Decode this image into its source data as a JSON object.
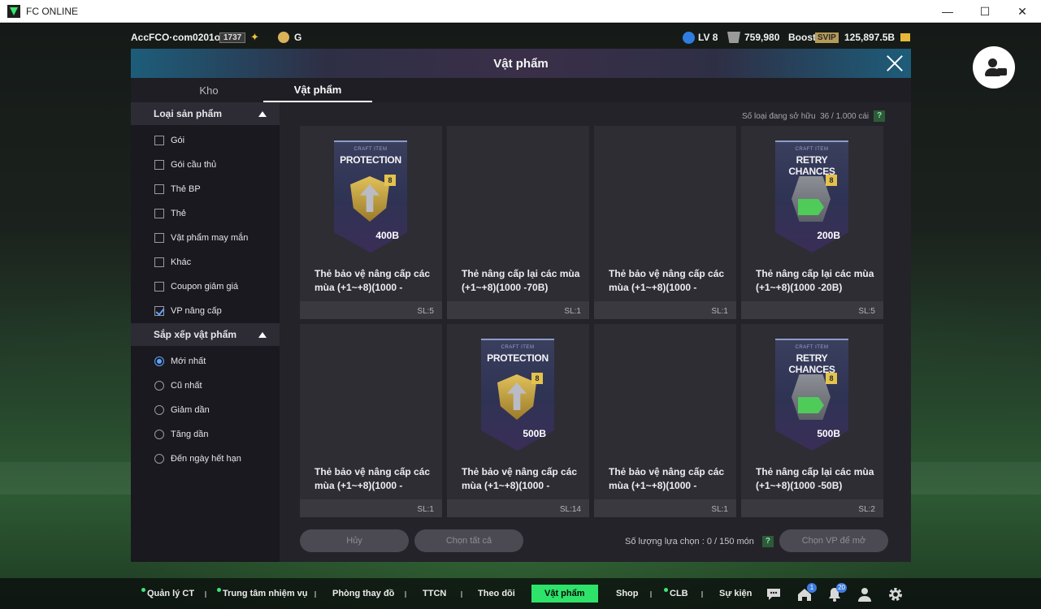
{
  "window": {
    "title": "FC ONLINE",
    "minimize": "—",
    "maximize": "☐",
    "close": "✕"
  },
  "topbar": {
    "username": "AccFCO·com0201oo",
    "user_level": "1737",
    "club_grade": "G",
    "level": "LV 8",
    "bp": "759,980",
    "boost_label": "Boost",
    "svip": "SVIP",
    "coins": "125,897.5B"
  },
  "modal": {
    "title": "Vật phẩm",
    "tabs": [
      {
        "label": "Kho",
        "active": false
      },
      {
        "label": "Vật phẩm",
        "active": true
      }
    ],
    "owned_label": "Số loại đang sở hữu",
    "owned_value": "36 / 1.000 cái",
    "help": "?",
    "sidebar": {
      "category_title": "Loại sản phẩm",
      "categories": [
        {
          "label": "Gói",
          "checked": false
        },
        {
          "label": "Gói cầu thủ",
          "checked": false
        },
        {
          "label": "Thẻ BP",
          "checked": false
        },
        {
          "label": "Thẻ",
          "checked": false
        },
        {
          "label": "Vật phẩm may mắn",
          "checked": false
        },
        {
          "label": "Khác",
          "checked": false
        },
        {
          "label": "Coupon giảm giá",
          "checked": false
        },
        {
          "label": "VP nâng cấp",
          "checked": true
        }
      ],
      "sort_title": "Sắp xếp vật phẩm",
      "sorts": [
        {
          "label": "Mới nhất",
          "selected": true
        },
        {
          "label": "Cũ nhất",
          "selected": false
        },
        {
          "label": "Giảm dần",
          "selected": false
        },
        {
          "label": "Tăng dần",
          "selected": false
        },
        {
          "label": "Đến ngày hết hạn",
          "selected": false
        }
      ]
    },
    "items": [
      {
        "caption": "CRAFT ITEM",
        "type": "PROTECTION",
        "grade": "8",
        "price": "400B",
        "name": "Thẻ bảo vệ nâng cấp các mùa (+1~+8)(1000 -",
        "qty": "SL:5",
        "image": true,
        "kind": "protection"
      },
      {
        "caption": "",
        "type": "",
        "grade": "",
        "price": "",
        "name": "Thẻ nâng cấp lại các mùa (+1~+8)(1000 -70B)",
        "qty": "SL:1",
        "image": false,
        "kind": ""
      },
      {
        "caption": "",
        "type": "",
        "grade": "",
        "price": "",
        "name": "Thẻ bảo vệ nâng cấp các mùa (+1~+8)(1000 -",
        "qty": "SL:1",
        "image": false,
        "kind": ""
      },
      {
        "caption": "CRAFT ITEM",
        "type": "RETRY CHANCES",
        "grade": "8",
        "price": "200B",
        "name": "Thẻ nâng cấp lại các mùa (+1~+8)(1000 -20B)",
        "qty": "SL:5",
        "image": true,
        "kind": "retry"
      },
      {
        "caption": "",
        "type": "",
        "grade": "",
        "price": "",
        "name": "Thẻ bảo vệ nâng cấp các mùa (+1~+8)(1000 -",
        "qty": "SL:1",
        "image": false,
        "kind": ""
      },
      {
        "caption": "CRAFT ITEM",
        "type": "PROTECTION",
        "grade": "8",
        "price": "500B",
        "name": "Thẻ bảo vệ nâng cấp các mùa (+1~+8)(1000 -",
        "qty": "SL:14",
        "image": true,
        "kind": "protection"
      },
      {
        "caption": "",
        "type": "",
        "grade": "",
        "price": "",
        "name": "Thẻ bảo vệ nâng cấp các mùa (+1~+8)(1000 -",
        "qty": "SL:1",
        "image": false,
        "kind": ""
      },
      {
        "caption": "CRAFT ITEM",
        "type": "RETRY CHANCES",
        "grade": "8",
        "price": "500B",
        "name": "Thẻ nâng cấp lại các mùa (+1~+8)(1000 -50B)",
        "qty": "SL:2",
        "image": true,
        "kind": "retry"
      }
    ],
    "footer": {
      "cancel": "Hủy",
      "select_all": "Chọn tất cả",
      "selection_label": "Số lượng lựa chọn : 0 / 150 món",
      "choose": "Chọn VP để mở"
    }
  },
  "bottom_nav": {
    "items": [
      {
        "label": "Quản lý CT",
        "dot": true,
        "active": false
      },
      {
        "label": "Trung tâm nhiệm vụ",
        "dot": true,
        "active": false
      },
      {
        "label": "Phòng thay đồ",
        "dot": false,
        "active": false
      },
      {
        "label": "TTCN",
        "dot": false,
        "active": false
      },
      {
        "label": "Theo dõi",
        "dot": false,
        "active": false
      },
      {
        "label": "Vật phẩm",
        "dot": false,
        "active": true
      },
      {
        "label": "Shop",
        "dot": false,
        "active": false
      },
      {
        "label": "CLB",
        "dot": true,
        "active": false
      },
      {
        "label": "Sự kiện",
        "dot": false,
        "active": false
      }
    ],
    "badges": {
      "home": "1",
      "notifications": "20"
    },
    "icons": [
      "chat-icon",
      "home-icon",
      "bell-icon",
      "profile-icon",
      "settings-icon"
    ]
  }
}
